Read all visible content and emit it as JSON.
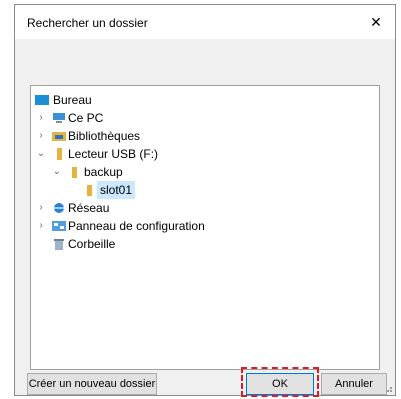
{
  "dialog": {
    "title": "Rechercher un dossier",
    "close_glyph": "✕"
  },
  "tree": {
    "items": [
      {
        "label": "Bureau",
        "icon": "desktop-icon",
        "expander": ""
      },
      {
        "label": "Ce PC",
        "icon": "computer-icon",
        "expander": "›"
      },
      {
        "label": "Bibliothèques",
        "icon": "libraries-icon",
        "expander": "›"
      },
      {
        "label": "Lecteur USB (F:)",
        "icon": "usb-drive-icon",
        "expander": "⌄"
      },
      {
        "label": "backup",
        "icon": "folder-icon",
        "expander": "⌄"
      },
      {
        "label": "slot01",
        "icon": "folder-icon",
        "expander": "",
        "selected": true
      },
      {
        "label": "Réseau",
        "icon": "network-icon",
        "expander": "›"
      },
      {
        "label": "Panneau de configuration",
        "icon": "control-panel-icon",
        "expander": "›"
      },
      {
        "label": "Corbeille",
        "icon": "recycle-bin-icon",
        "expander": ""
      }
    ]
  },
  "buttons": {
    "new_folder": "Créer un nouveau dossier",
    "ok": "OK",
    "cancel": "Annuler"
  },
  "colors": {
    "selection": "#cce8ff",
    "highlight": "#e0182a",
    "folder": "#e8b33c"
  }
}
